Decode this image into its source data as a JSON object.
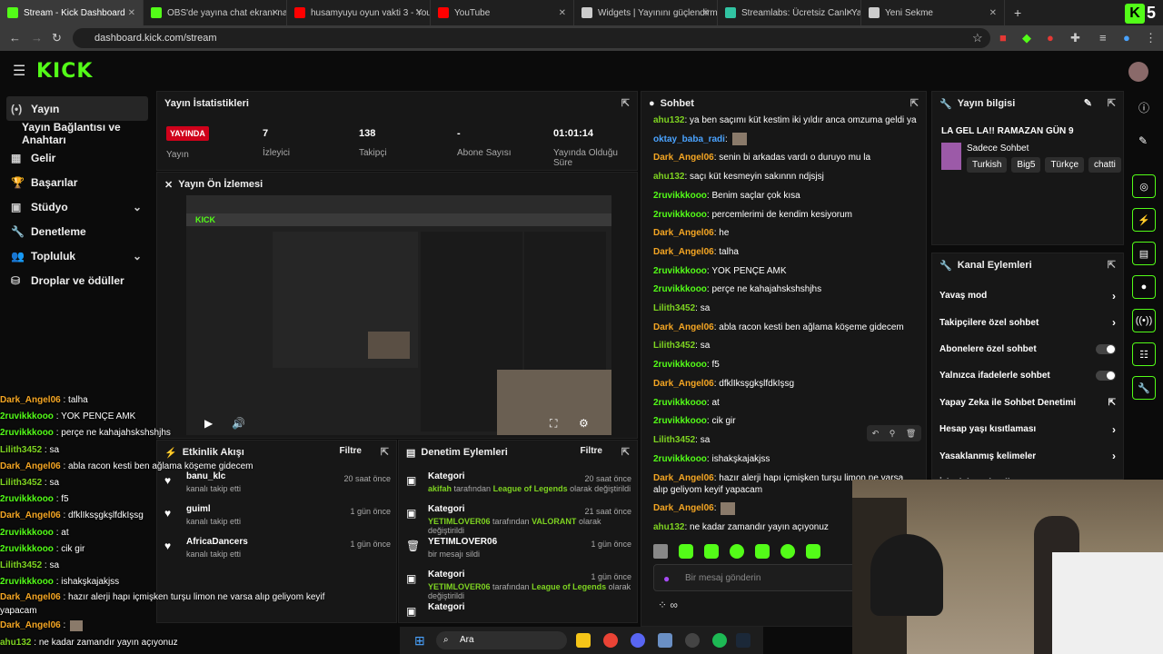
{
  "tabs": [
    {
      "label": "Stream - Kick Dashboard",
      "color": "#53fc18",
      "active": true
    },
    {
      "label": "OBS'de yayına chat ekranı nası",
      "color": "#53fc18"
    },
    {
      "label": "husamyuyu oyun vakti 3 - YouT",
      "color": "#ff0000"
    },
    {
      "label": "YouTube",
      "color": "#ff0000"
    },
    {
      "label": "Widgets | Yayınını güçlendirme",
      "color": "#cccccc"
    },
    {
      "label": "Streamlabs: Ücretsiz Canlı Yay",
      "color": "#31c3a2"
    },
    {
      "label": "Yeni Sekme",
      "color": "#cccccc"
    }
  ],
  "url": "dashboard.kick.com/stream",
  "brand": {
    "logo": "KICK",
    "accent": "#53fc18"
  },
  "sidebar": [
    {
      "label": "Yayın",
      "icon": "broadcast-icon",
      "active": true
    },
    {
      "label": "Yayın Bağlantısı ve Anahtarı",
      "icon": ""
    },
    {
      "label": "Gelir",
      "icon": "money-icon"
    },
    {
      "label": "Başarılar",
      "icon": "trophy-icon"
    },
    {
      "label": "Stüdyo",
      "icon": "studio-icon",
      "chevron": true
    },
    {
      "label": "Denetleme",
      "icon": "wrench-icon"
    },
    {
      "label": "Topluluk",
      "icon": "community-icon",
      "chevron": true
    },
    {
      "label": "Droplar ve ödüller",
      "icon": "gift-icon"
    }
  ],
  "stats": {
    "title": "Yayın İstatistikleri",
    "status": "YAYINDA",
    "status_label": "Yayın",
    "items": [
      {
        "value": "7",
        "label": "İzleyici"
      },
      {
        "value": "138",
        "label": "Takipçi"
      },
      {
        "value": "-",
        "label": "Abone Sayısı"
      },
      {
        "value": "01:01:14",
        "label": "Yayında Olduğu Süre"
      }
    ]
  },
  "preview": {
    "title": "Yayın Ön İzlemesi"
  },
  "activity": {
    "title": "Etkinlik Akışı",
    "filter": "Filtre",
    "items": [
      {
        "name": "banu_klc",
        "sub": "kanalı takip etti",
        "time": "20 saat önce"
      },
      {
        "name": "guiml",
        "sub": "kanalı takip etti",
        "time": "1 gün önce"
      },
      {
        "name": "AfricaDancers",
        "sub": "kanalı takip etti",
        "time": "1 gün önce"
      }
    ]
  },
  "moderation": {
    "title": "Denetim Eylemleri",
    "filter": "Filtre",
    "items": [
      {
        "title": "Kategori",
        "user": "akifah",
        "mid": "tarafından",
        "cat": "League of Legends",
        "end": "olarak değiştirildi",
        "time": "20 saat önce",
        "icon": "category-icon"
      },
      {
        "title": "Kategori",
        "user": "YETIMLOVER06",
        "mid": "tarafından",
        "cat": "VALORANT",
        "end": "olarak değiştirildi",
        "time": "21 saat önce",
        "icon": "category-icon"
      },
      {
        "title": "YETIMLOVER06",
        "user": "",
        "mid": "",
        "cat": "",
        "end": "bir mesajı sildi",
        "time": "1 gün önce",
        "icon": "trash-icon"
      },
      {
        "title": "Kategori",
        "user": "YETIMLOVER06",
        "mid": "tarafından",
        "cat": "League of Legends",
        "end": "olarak değiştirildi",
        "time": "1 gün önce",
        "icon": "category-icon"
      },
      {
        "title": "Kategori",
        "user": "",
        "mid": "",
        "cat": "",
        "end": "",
        "time": "",
        "icon": "category-icon"
      }
    ]
  },
  "chat": {
    "title": "Sohbet",
    "input_placeholder": "Bir mesaj gönderin",
    "messages": [
      {
        "user": "ahu132",
        "color": "lime",
        "text": "ya ben saçımı küt kestim iki yıldır anca omzuma geldi yaa"
      },
      {
        "user": "oktay_baba_radi",
        "color": "blue",
        "text": ""
      },
      {
        "user": "Dark_Angel06",
        "color": "orange",
        "text": "senin bi arkadas vardı o duruyo mu la"
      },
      {
        "user": "ahu132",
        "color": "lime",
        "text": "saçı küt kesmeyin sakınnn ndjsjsj"
      },
      {
        "user": "2ruvikkkooo",
        "color": "green",
        "text": "Benim saçlar çok kısa"
      },
      {
        "user": "2ruvikkkooo",
        "color": "green",
        "text": "percemlerimi de kendim kesiyorum"
      },
      {
        "user": "Dark_Angel06",
        "color": "orange",
        "text": "he"
      },
      {
        "user": "Dark_Angel06",
        "color": "orange",
        "text": "talha"
      },
      {
        "user": "2ruvikkkooo",
        "color": "green",
        "text": "YOK PENÇE AMK"
      },
      {
        "user": "2ruvikkkooo",
        "color": "green",
        "text": "perçe ne kahajahskshshjhs"
      },
      {
        "user": "Lilith3452",
        "color": "lime",
        "text": "sa"
      },
      {
        "user": "Dark_Angel06",
        "color": "orange",
        "text": "abla racon kesti ben ağlama köşeme gidecem"
      },
      {
        "user": "Lilith3452",
        "color": "lime",
        "text": "sa"
      },
      {
        "user": "2ruvikkkooo",
        "color": "green",
        "text": "f5"
      },
      {
        "user": "Dark_Angel06",
        "color": "orange",
        "text": "dfklIksşgkşlfdkIşsg"
      },
      {
        "user": "2ruvikkkooo",
        "color": "green",
        "text": "at"
      },
      {
        "user": "2ruvikkkooo",
        "color": "green",
        "text": "cik gir"
      },
      {
        "user": "Lilith3452",
        "color": "lime",
        "text": "sa"
      },
      {
        "user": "2ruvikkkooo",
        "color": "green",
        "text": "ishakşkajakjss"
      },
      {
        "user": "Dark_Angel06",
        "color": "orange",
        "text": "hazır alerji hapı içmişken turşu limon ne varsa alıp geliyom keyif yapacam"
      },
      {
        "user": "Dark_Angel06",
        "color": "orange",
        "text": ""
      },
      {
        "user": "ahu132",
        "color": "lime",
        "text": "ne kadar zamandır yayın açıyonuz"
      }
    ]
  },
  "stream_info": {
    "title": "Yayın bilgisi",
    "stream_title": "LA GEL LA!! RAMAZAN GÜN 9",
    "category": "Sadece Sohbet",
    "tags": [
      "Turkish",
      "Big5",
      "Türkçe",
      "chatti"
    ]
  },
  "channel_actions": {
    "title": "Kanal Eylemleri",
    "items": [
      {
        "label": "Yavaş mod",
        "type": "chevron"
      },
      {
        "label": "Takipçilere özel sohbet",
        "type": "chevron"
      },
      {
        "label": "Abonelere özel sohbet",
        "type": "toggle"
      },
      {
        "label": "Yalnızca ifadelerle sohbet",
        "type": "toggle"
      },
      {
        "label": "Yapay Zeka ile Sohbet Denetimi",
        "type": "link"
      },
      {
        "label": "Hesap yaşı kısıtlaması",
        "type": "chevron"
      },
      {
        "label": "Yasaklanmış kelimeler",
        "type": "chevron"
      },
      {
        "label": "İzleyici Yönlendir",
        "type": "none"
      }
    ]
  },
  "overlay_chat": [
    {
      "user": "Dark_Angel06",
      "color": "orange",
      "text": "talha"
    },
    {
      "user": "2ruvikkkooo",
      "color": "green",
      "text": "YOK PENÇE AMK"
    },
    {
      "user": "2ruvikkkooo",
      "color": "green",
      "text": "perçe ne kahajahskshshjhs"
    },
    {
      "user": "Lilith3452",
      "color": "lime",
      "text": "sa"
    },
    {
      "user": "Dark_Angel06",
      "color": "orange",
      "text": "abla racon kesti ben ağlama köşeme gidecem"
    },
    {
      "user": "Lilith3452",
      "color": "lime",
      "text": "sa"
    },
    {
      "user": "2ruvikkkooo",
      "color": "green",
      "text": "f5"
    },
    {
      "user": "Dark_Angel06",
      "color": "orange",
      "text": "dfklIksşgkşlfdkIşsg"
    },
    {
      "user": "2ruvikkkooo",
      "color": "green",
      "text": "at"
    },
    {
      "user": "2ruvikkkooo",
      "color": "green",
      "text": "cik gir"
    },
    {
      "user": "Lilith3452",
      "color": "lime",
      "text": "sa"
    },
    {
      "user": "2ruvikkkooo",
      "color": "green",
      "text": "ishakşkajakjss"
    },
    {
      "user": "Dark_Angel06",
      "color": "orange",
      "text": "hazır alerji hapı içmişken turşu limon ne varsa alıp geliyom keyif yapacam"
    },
    {
      "user": "Dark_Angel06",
      "color": "orange",
      "text": ""
    },
    {
      "user": "ahu132",
      "color": "lime",
      "text": "ne kadar zamandır yayın açıyonuz"
    }
  ],
  "taskbar": {
    "search": "Ara"
  },
  "corner_badge": "5"
}
